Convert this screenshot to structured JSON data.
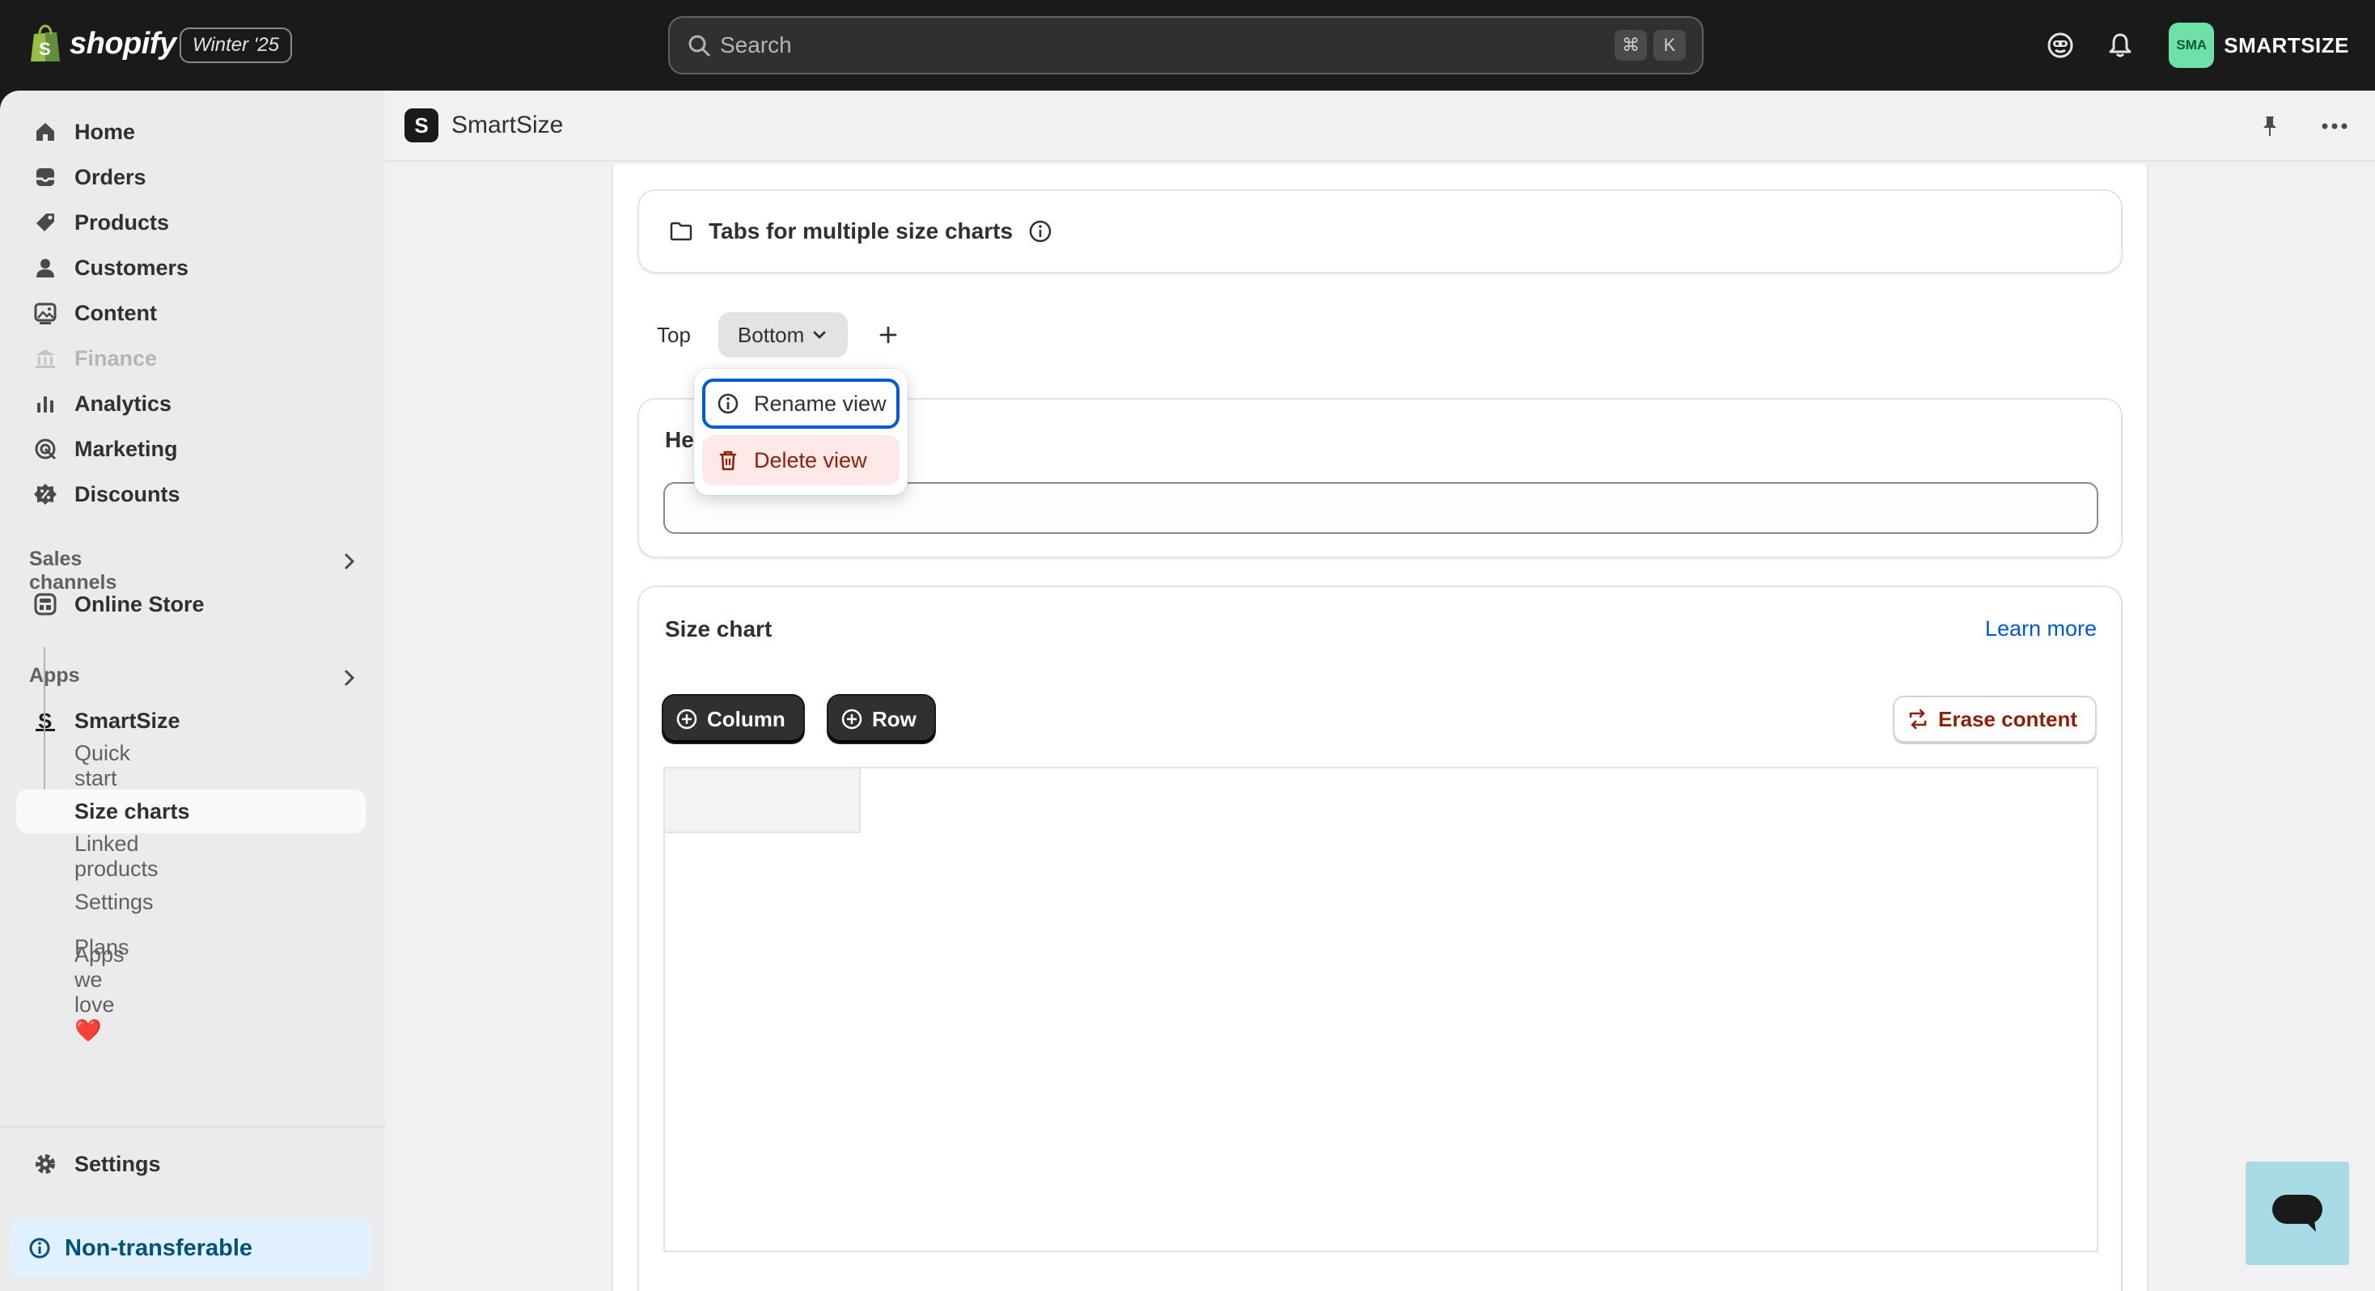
{
  "topbar": {
    "brand": "shopify",
    "edition_badge": "Winter '25",
    "search_placeholder": "Search",
    "shortcut_keys": [
      "⌘",
      "K"
    ],
    "avatar_initials": "SMA",
    "store_name": "SMARTSIZE"
  },
  "sidebar": {
    "nav": [
      {
        "label": "Home",
        "icon": "home-icon"
      },
      {
        "label": "Orders",
        "icon": "orders-icon"
      },
      {
        "label": "Products",
        "icon": "tag-icon"
      },
      {
        "label": "Customers",
        "icon": "person-icon"
      },
      {
        "label": "Content",
        "icon": "image-icon"
      },
      {
        "label": "Finance",
        "icon": "bank-icon",
        "disabled": true
      },
      {
        "label": "Analytics",
        "icon": "bar-chart-icon"
      },
      {
        "label": "Marketing",
        "icon": "target-icon"
      },
      {
        "label": "Discounts",
        "icon": "discount-icon"
      }
    ],
    "sales_channels_label": "Sales channels",
    "online_store": "Online Store",
    "apps_label": "Apps",
    "app_name": "SmartSize",
    "app_sub": [
      "Quick start",
      "Size charts",
      "Linked products",
      "Settings",
      "Plans",
      "Apps we love ❤️"
    ],
    "active_sub": "Size charts",
    "settings": "Settings",
    "non_transferable": "Non-transferable"
  },
  "app_header": {
    "title": "SmartSize",
    "logo_letter": "S"
  },
  "tabs_card": {
    "title": "Tabs for multiple size charts"
  },
  "view_tabs": {
    "tabs": [
      "Top",
      "Bottom"
    ],
    "active": "Bottom"
  },
  "popover": {
    "rename": "Rename view",
    "delete": "Delete view"
  },
  "heading_card": {
    "label_visible": "Hea"
  },
  "size_chart": {
    "title": "Size chart",
    "learn_more": "Learn more",
    "add_column": "Column",
    "add_row": "Row",
    "erase": "Erase content"
  },
  "colors": {
    "topbar_bg": "#1a1a1a",
    "sidebar_bg": "#ebebeb",
    "link_blue": "#005bd3",
    "critical_text": "#8e1f0b",
    "critical_bg": "#fee9e8",
    "avatar_green": "#6fe0a8",
    "chat_bg": "#a8dbe6"
  }
}
